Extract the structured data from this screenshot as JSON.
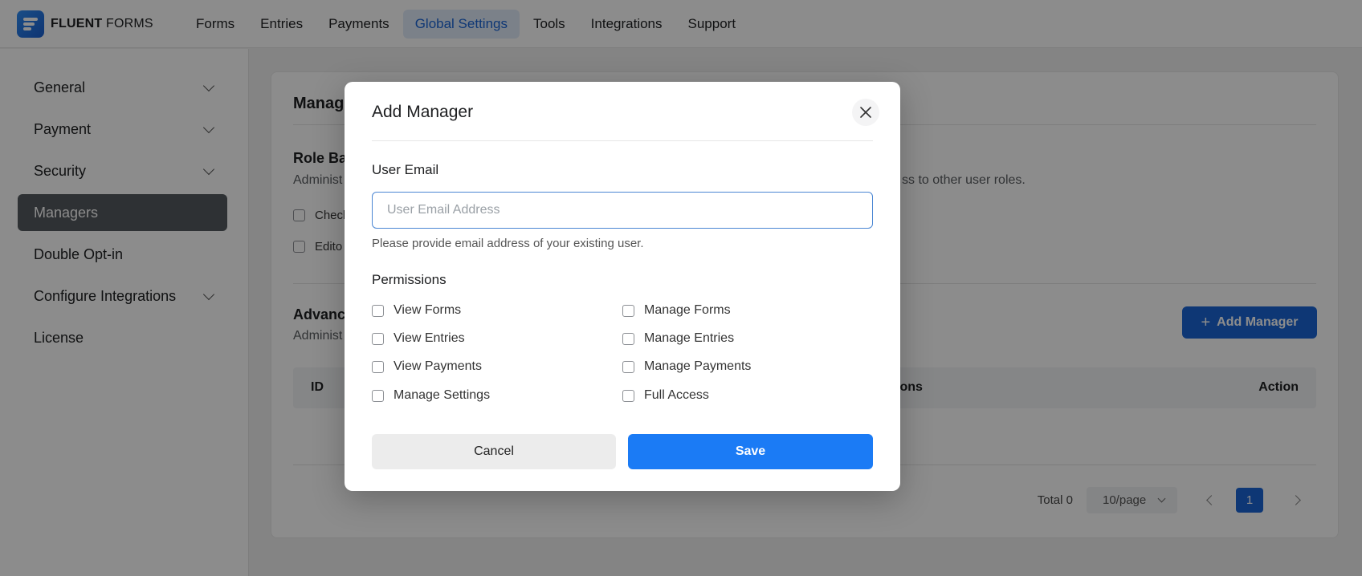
{
  "brand": {
    "bold": "FLUENT",
    "light": "FORMS"
  },
  "nav": [
    "Forms",
    "Entries",
    "Payments",
    "Global Settings",
    "Tools",
    "Integrations",
    "Support"
  ],
  "nav_active": "Global Settings",
  "sidebar": {
    "items": [
      {
        "label": "General",
        "expandable": true
      },
      {
        "label": "Payment",
        "expandable": true
      },
      {
        "label": "Security",
        "expandable": true
      },
      {
        "label": "Managers",
        "expandable": false,
        "active": true
      },
      {
        "label": "Double Opt-in",
        "expandable": false
      },
      {
        "label": "Configure Integrations",
        "expandable": true
      },
      {
        "label": "License",
        "expandable": false
      }
    ]
  },
  "main": {
    "title": "Manag",
    "role_section": {
      "title": "Role Bas",
      "desc_left": "Administ",
      "desc_right": "ss to other user roles.",
      "roles": [
        "Check",
        "Edito"
      ]
    },
    "advanced_section": {
      "title": "Advanc",
      "desc": "Administ"
    },
    "add_button": "Add Manager",
    "table_headers": {
      "id": "ID",
      "permissions": "ions",
      "action": "Action"
    },
    "pagination": {
      "total": "Total 0",
      "page_size": "10/page",
      "current_page": "1"
    }
  },
  "modal": {
    "title": "Add Manager",
    "email_label": "User Email",
    "email_value": "",
    "email_placeholder": "User Email Address",
    "email_help": "Please provide email address of your existing user.",
    "permissions_label": "Permissions",
    "permissions_left": [
      "View Forms",
      "View Entries",
      "View Payments",
      "Manage Settings"
    ],
    "permissions_right": [
      "Manage Forms",
      "Manage Entries",
      "Manage Payments",
      "Full Access"
    ],
    "cancel_label": "Cancel",
    "save_label": "Save"
  },
  "colors": {
    "primary": "#1a65d6",
    "save": "#1b7bf5",
    "sidebar_active": "#555a5f"
  }
}
